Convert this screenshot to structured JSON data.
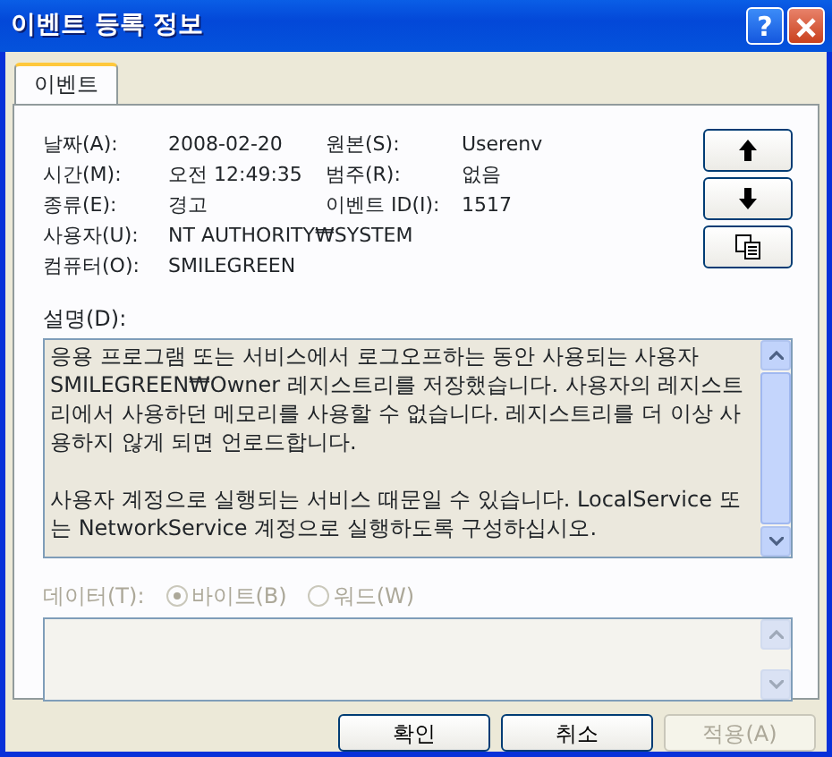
{
  "window": {
    "title": "이벤트 등록 정보",
    "help": "?"
  },
  "tabs": [
    {
      "label": "이벤트",
      "selected": true
    }
  ],
  "info_rows": [
    [
      {
        "label": "날짜(A):",
        "value": "2008-02-20"
      },
      {
        "label": "원본(S):",
        "value": "Userenv"
      }
    ],
    [
      {
        "label": "시간(M):",
        "value": "오전 12:49:35"
      },
      {
        "label": "범주(R):",
        "value": "없음"
      }
    ],
    [
      {
        "label": "종류(E):",
        "value": "경고"
      },
      {
        "label": "이벤트 ID(I):",
        "value": "1517"
      }
    ],
    [
      {
        "label": "사용자(U):",
        "value": "NT AUTHORITY₩SYSTEM"
      }
    ],
    [
      {
        "label": "컴퓨터(O):",
        "value": "SMILEGREEN"
      }
    ]
  ],
  "side_buttons": [
    {
      "kind": "up"
    },
    {
      "kind": "down"
    },
    {
      "kind": "copy"
    }
  ],
  "description": {
    "label": "설명(D):",
    "paragraphs": [
      "응용 프로그램 또는 서비스에서 로그오프하는 동안 사용되는 사용자 SMILEGREEN₩Owner 레지스트리를 저장했습니다. 사용자의 레지스트리에서 사용하던 메모리를 사용할 수 없습니다. 레지스트리를 더 이상 사용하지 않게 되면 언로드합니다.",
      "사용자 계정으로 실행되는 서비스 때문일 수 있습니다. LocalService 또는 NetworkService 계정으로 실행하도록 구성하십시오."
    ]
  },
  "data": {
    "label": "데이터(T):",
    "disabled": true,
    "options": [
      {
        "label": "바이트(B)",
        "selected": true
      },
      {
        "label": "워드(W)",
        "selected": false
      }
    ]
  },
  "buttons": [
    {
      "label": "확인",
      "disabled": false
    },
    {
      "label": "취소",
      "disabled": false
    },
    {
      "label": "적용(A)",
      "disabled": true
    }
  ]
}
